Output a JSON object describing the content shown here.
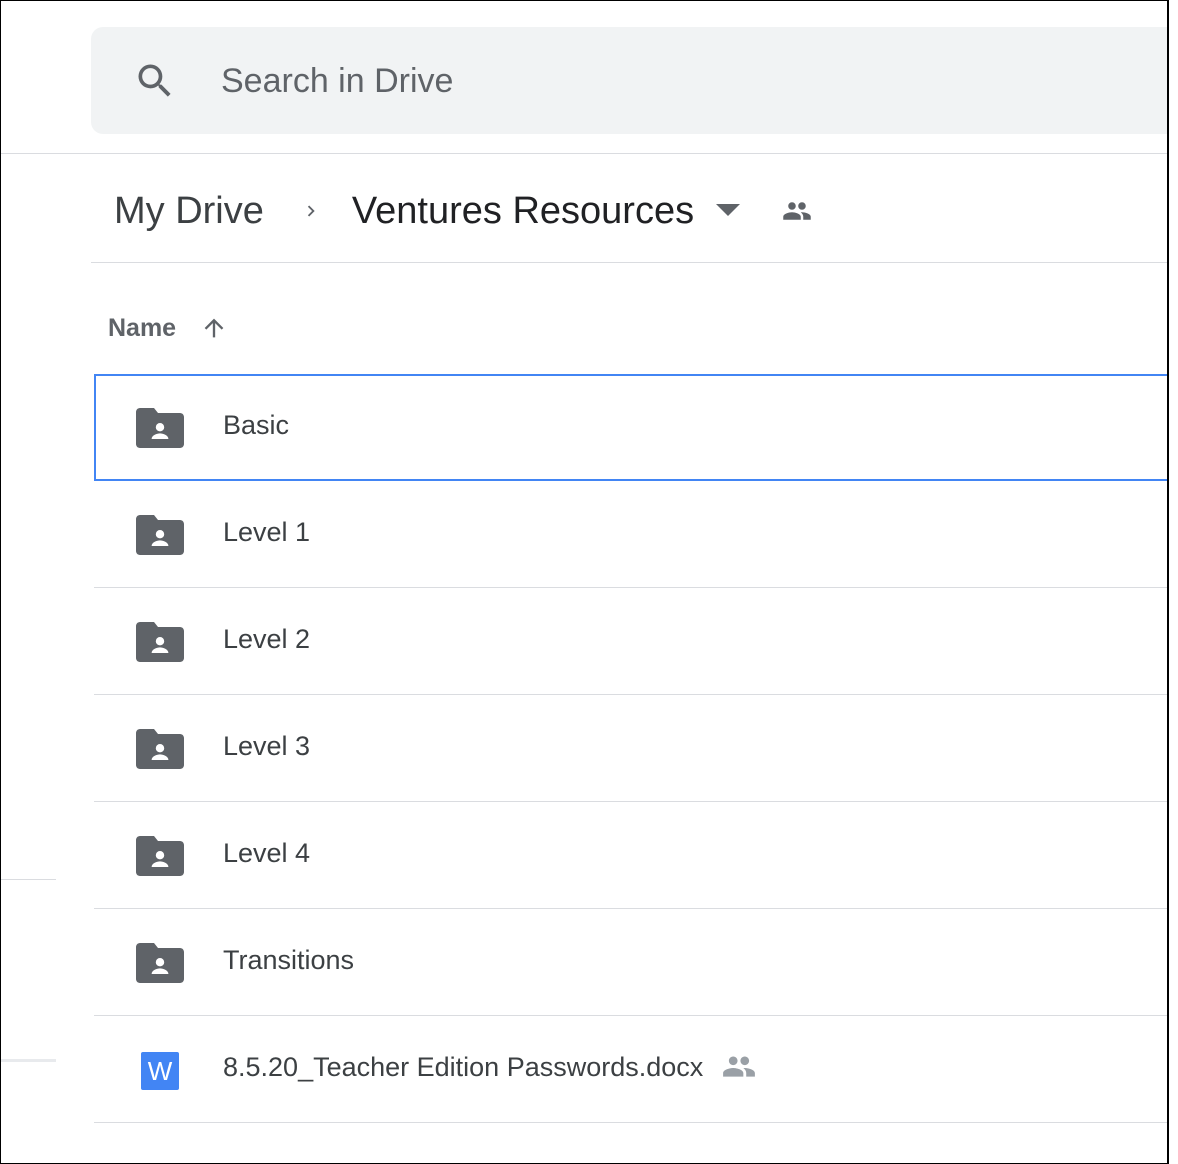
{
  "search": {
    "placeholder": "Search in Drive",
    "icon": "search-icon"
  },
  "breadcrumb": {
    "root": "My Drive",
    "current": "Ventures Resources",
    "separator_icon": "chevron-right-icon",
    "caret_icon": "caret-down-icon",
    "shared_icon": "shared-people-icon"
  },
  "list_header": {
    "name_label": "Name",
    "sort_icon": "arrow-up-icon"
  },
  "files": [
    {
      "name": "Basic",
      "type": "shared-folder",
      "icon": "shared-folder-icon",
      "selected": true
    },
    {
      "name": "Level 1",
      "type": "shared-folder",
      "icon": "shared-folder-icon"
    },
    {
      "name": "Level 2",
      "type": "shared-folder",
      "icon": "shared-folder-icon"
    },
    {
      "name": "Level 3",
      "type": "shared-folder",
      "icon": "shared-folder-icon"
    },
    {
      "name": "Level 4",
      "type": "shared-folder",
      "icon": "shared-folder-icon"
    },
    {
      "name": "Transitions",
      "type": "shared-folder",
      "icon": "shared-folder-icon"
    },
    {
      "name": "8.5.20_Teacher Edition Passwords.docx",
      "type": "word-document",
      "icon": "word-doc-icon",
      "icon_letter": "W",
      "shared": true
    }
  ],
  "colors": {
    "selection_border": "#4285f4",
    "folder_icon": "#5f6368",
    "word_icon": "#4285f4",
    "search_bg": "#f1f3f4"
  }
}
